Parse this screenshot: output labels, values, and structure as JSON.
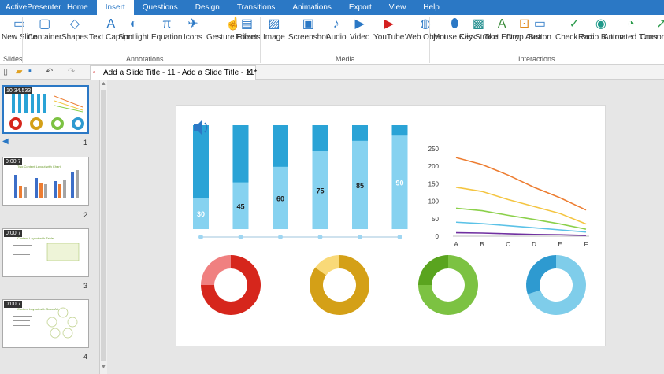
{
  "app": {
    "title": "ActivePresenter"
  },
  "menu": [
    "Home",
    "Insert",
    "Questions",
    "Design",
    "Transitions",
    "Animations",
    "Export",
    "View",
    "Help"
  ],
  "active_tab": "Insert",
  "ribbon": {
    "slides": [
      {
        "label": "New Slide",
        "icon": "new-slide-icon"
      }
    ],
    "annotations": [
      {
        "label": "Container",
        "icon": "container-icon"
      },
      {
        "label": "Shapes",
        "icon": "shapes-icon"
      },
      {
        "label": "Text Caption",
        "icon": "text-caption-icon"
      },
      {
        "label": "Spotlight",
        "icon": "spotlight-icon"
      },
      {
        "label": "Equation",
        "icon": "equation-icon"
      },
      {
        "label": "Icons",
        "icon": "plane-icon"
      },
      {
        "label": "Gesture Effects",
        "icon": "gesture-icon"
      },
      {
        "label": "Footer",
        "icon": "footer-icon"
      }
    ],
    "media": [
      {
        "label": "Image",
        "icon": "image-icon"
      },
      {
        "label": "Screenshot",
        "icon": "screenshot-icon"
      },
      {
        "label": "Audio",
        "icon": "audio-icon"
      },
      {
        "label": "Video",
        "icon": "video-icon"
      },
      {
        "label": "YouTube",
        "icon": "youtube-icon"
      },
      {
        "label": "Web Object",
        "icon": "globe-icon"
      }
    ],
    "interactions": [
      {
        "label": "Mouse Click",
        "icon": "mouse-icon"
      },
      {
        "label": "Key Stroke",
        "icon": "key-icon"
      },
      {
        "label": "Text Entry",
        "icon": "text-entry-icon"
      },
      {
        "label": "Drop Area",
        "icon": "drop-area-icon"
      },
      {
        "label": "Button",
        "icon": "button-icon"
      },
      {
        "label": "Check Box",
        "icon": "checkbox-icon"
      },
      {
        "label": "Radio Button",
        "icon": "radio-icon"
      },
      {
        "label": "Animated Timer",
        "icon": "timer-icon"
      },
      {
        "label": "Cursor Path",
        "icon": "cursor-path-icon"
      }
    ],
    "group_labels": {
      "slides": "Slides",
      "annotations": "Annotations",
      "media": "Media",
      "interactions": "Interactions"
    }
  },
  "document_tab": {
    "title": "Add a Slide Title - 11 - Add a Slide Title - 11*"
  },
  "thumbnails": [
    {
      "number": "1",
      "timer": "10:34.533",
      "title": ""
    },
    {
      "number": "2",
      "timer": "0:00.7",
      "title": "Two Content Layout with Chart"
    },
    {
      "number": "3",
      "timer": "0:00.7",
      "title": "Content Layout with Table"
    },
    {
      "number": "4",
      "timer": "0:00.7",
      "title": "Content Layout with SmartArt"
    }
  ],
  "chart_data": [
    {
      "type": "bar",
      "categories": [
        "",
        "",
        "",
        "",
        "",
        ""
      ],
      "values": [
        30,
        45,
        60,
        75,
        85,
        90
      ],
      "ylim": [
        0,
        100
      ],
      "title": "",
      "xlabel": "",
      "ylabel": "",
      "colors": {
        "fill": "#2aa3d6",
        "light": "#86d2f0"
      }
    },
    {
      "type": "line",
      "categories": [
        "A",
        "B",
        "C",
        "D",
        "E",
        "F"
      ],
      "ylim": [
        0,
        250
      ],
      "yticks": [
        0,
        50,
        100,
        150,
        200,
        250
      ],
      "title": "",
      "xlabel": "",
      "ylabel": "",
      "grid": false,
      "series": [
        {
          "values": [
            225,
            205,
            175,
            140,
            110,
            75
          ],
          "color": "#ed7d31"
        },
        {
          "values": [
            140,
            128,
            105,
            85,
            65,
            35
          ],
          "color": "#f4c542"
        },
        {
          "values": [
            80,
            73,
            60,
            48,
            35,
            20
          ],
          "color": "#8bd04a"
        },
        {
          "values": [
            40,
            36,
            30,
            24,
            18,
            12
          ],
          "color": "#5bc2e7"
        },
        {
          "values": [
            10,
            9,
            7,
            5,
            4,
            2
          ],
          "color": "#7030a0"
        }
      ]
    },
    {
      "type": "pie",
      "values": [
        75,
        25
      ],
      "colors": [
        "#d6261c",
        "#f08080"
      ]
    },
    {
      "type": "pie",
      "values": [
        85,
        15
      ],
      "colors": [
        "#d4a017",
        "#f9d978"
      ]
    },
    {
      "type": "pie",
      "values": [
        75,
        25
      ],
      "colors": [
        "#7cc242",
        "#5aa41f"
      ]
    },
    {
      "type": "pie",
      "values": [
        70,
        30
      ],
      "colors": [
        "#7fcdea",
        "#2e9ad0"
      ]
    }
  ]
}
